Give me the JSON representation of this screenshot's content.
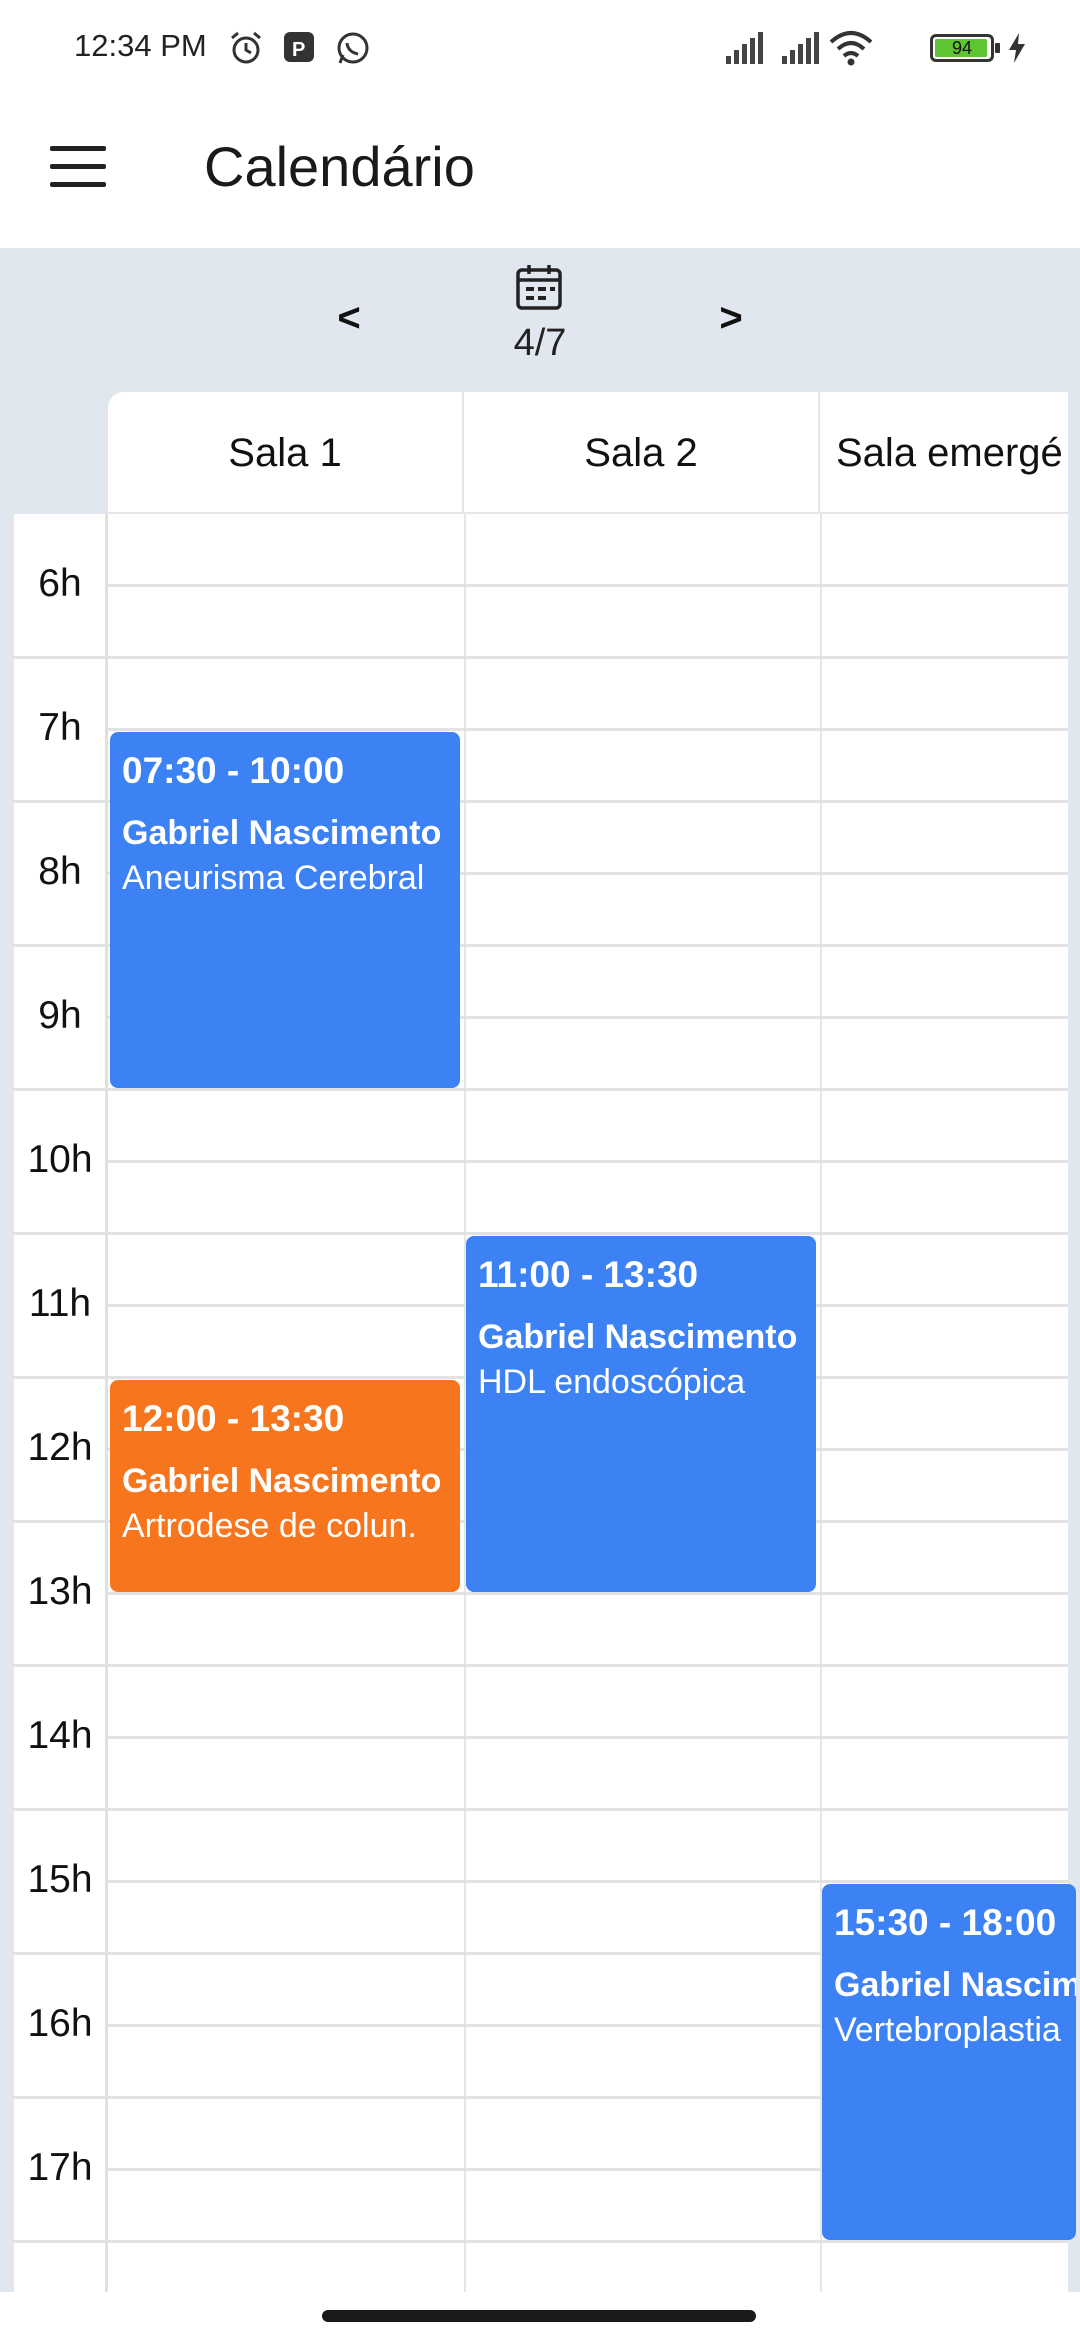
{
  "status_bar": {
    "time": "12:34 PM",
    "battery": "94",
    "icons": [
      "alarm-icon",
      "parking-icon",
      "whatsapp-icon",
      "signal-icon",
      "signal-icon",
      "wifi-icon",
      "battery-icon",
      "charging-icon"
    ]
  },
  "app_bar": {
    "title": "Calendário",
    "menu_icon": "menu-icon"
  },
  "date_nav": {
    "prev_label": "<",
    "next_label": ">",
    "date": "4/7",
    "calendar_icon": "calendar-icon"
  },
  "rooms": [
    "Sala 1",
    "Sala  2",
    "Sala  emergé"
  ],
  "hours": [
    "6h",
    "7h",
    "8h",
    "9h",
    "10h",
    "11h",
    "12h",
    "13h",
    "14h",
    "15h",
    "16h",
    "17h"
  ],
  "events": [
    {
      "room": 0,
      "start": 7.5,
      "end": 10.0,
      "time": "07:30 - 10:00",
      "name": "Gabriel Nascimento",
      "procedure": "Aneurisma Cerebral",
      "color": "#3d82f4"
    },
    {
      "room": 1,
      "start": 11.0,
      "end": 13.5,
      "time": "11:00 - 13:30",
      "name": "Gabriel Nascimento",
      "procedure": "HDL endoscópica",
      "color": "#3d82f4"
    },
    {
      "room": 0,
      "start": 12.0,
      "end": 13.5,
      "time": "12:00 - 13:30",
      "name": "Gabriel Nascimento",
      "procedure": "Artrodese de colun.",
      "color": "#f7751c"
    },
    {
      "room": 2,
      "start": 15.5,
      "end": 18.0,
      "time": "15:30 - 18:00",
      "name": "Gabriel Nascim",
      "procedure": "Vertebroplastia",
      "color": "#3d82f4"
    }
  ]
}
